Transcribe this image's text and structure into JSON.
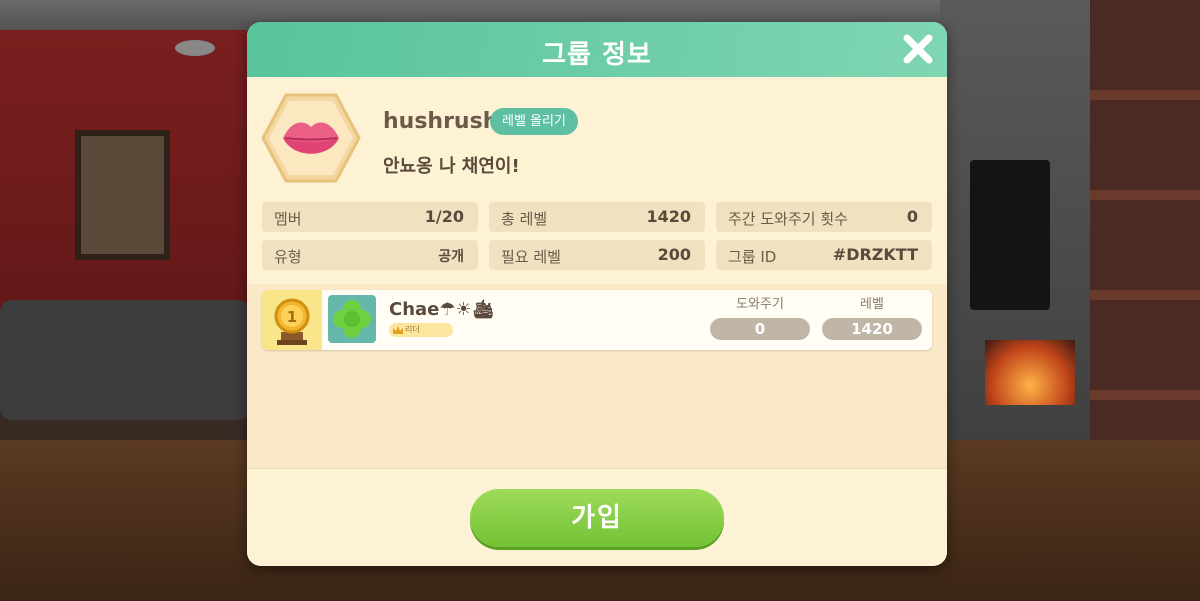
{
  "dialog": {
    "title": "그룹 정보",
    "close_icon": "close-icon"
  },
  "group": {
    "name": "hushrush",
    "level_up_label": "레벨 올리기",
    "description": "안뇨옹 나 채연이!",
    "emblem_icon": "lips-icon"
  },
  "stats": [
    {
      "key": "멤버",
      "value": "1/20"
    },
    {
      "key": "총 레벨",
      "value": "1420"
    },
    {
      "key": "주간 도와주기 횟수",
      "value": "0"
    },
    {
      "key": "유형",
      "value": "공개"
    },
    {
      "key": "필요 레벨",
      "value": "200"
    },
    {
      "key": "그룹 ID",
      "value": "#DRZKTT"
    }
  ],
  "members": {
    "columns": {
      "help": "도와주기",
      "level": "레벨"
    },
    "rows": [
      {
        "rank": "1",
        "name": "Chae☂☀🛳",
        "role_badge": "리더",
        "help": "0",
        "level": "1420",
        "avatar_icon": "clover-icon"
      }
    ]
  },
  "footer": {
    "join_label": "가입"
  },
  "colors": {
    "header": "#6ccfa8",
    "panel": "#fdf3d4",
    "join_button": "#86cd45",
    "level_up_badge": "#5ebfa2"
  }
}
